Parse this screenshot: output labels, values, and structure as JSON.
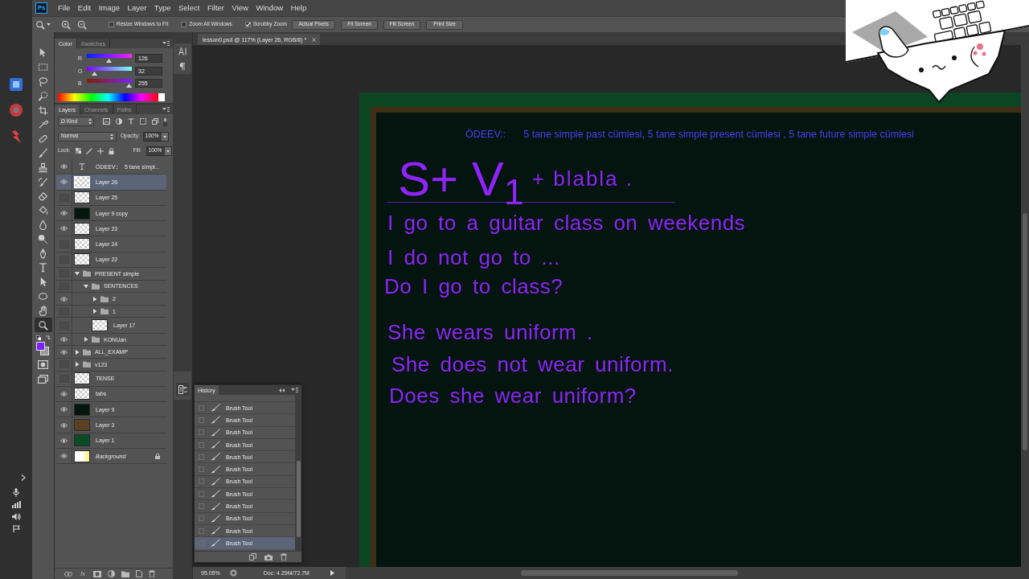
{
  "menu_bar": {
    "logo": "Ps",
    "items": [
      "File",
      "Edit",
      "Image",
      "Layer",
      "Type",
      "Select",
      "Filter",
      "View",
      "Window",
      "Help"
    ]
  },
  "options_bar": {
    "checkboxes": [
      {
        "label": "Resize Windows to Fit",
        "checked": false
      },
      {
        "label": "Zoom All Windows",
        "checked": false
      },
      {
        "label": "Scrubby Zoom",
        "checked": true
      }
    ],
    "buttons": [
      "Actual Pixels",
      "Fit Screen",
      "Fill Screen",
      "Print Size"
    ]
  },
  "toolbox": {
    "tools": [
      {
        "kind": "move",
        "selected": false
      },
      {
        "kind": "marquee",
        "selected": false
      },
      {
        "kind": "lasso",
        "selected": false
      },
      {
        "kind": "quick_select",
        "selected": false
      },
      {
        "kind": "crop",
        "selected": false
      },
      {
        "kind": "eyedropper",
        "selected": false
      },
      {
        "kind": "healing",
        "selected": false
      },
      {
        "kind": "brush",
        "selected": false
      },
      {
        "kind": "stamp",
        "selected": false
      },
      {
        "kind": "history_brush",
        "selected": false
      },
      {
        "kind": "eraser",
        "selected": false
      },
      {
        "kind": "bucket",
        "selected": false
      },
      {
        "kind": "blur",
        "selected": false
      },
      {
        "kind": "dodge",
        "selected": false
      },
      {
        "kind": "pen",
        "selected": false
      },
      {
        "kind": "type",
        "selected": false
      },
      {
        "kind": "path_select",
        "selected": false
      },
      {
        "kind": "ellipse",
        "selected": false
      },
      {
        "kind": "hand",
        "selected": false
      },
      {
        "kind": "zoom",
        "selected": true
      }
    ],
    "swatches": [
      {
        "kind": "foreground",
        "color": "#7e20ff"
      },
      {
        "kind": "background",
        "color": "#9a9a9a"
      }
    ]
  },
  "color_panel": {
    "tabs": [
      {
        "label": "Color",
        "selected": true
      },
      {
        "label": "Swatches",
        "selected": false
      }
    ],
    "sliders": [
      {
        "label": "R",
        "value": "126",
        "level": 0.49
      },
      {
        "label": "G",
        "value": "32",
        "level": 0.13
      },
      {
        "label": "B",
        "value": "255",
        "level": 1
      }
    ]
  },
  "layers_panel": {
    "tabs": [
      {
        "label": "Layers",
        "selected": true
      },
      {
        "label": "Channels",
        "selected": false
      },
      {
        "label": "Paths",
        "selected": false
      }
    ],
    "filter": "Kind",
    "filter_on": true,
    "blend_mode": "Normal",
    "opacity_label": "Opacity:",
    "opacity": "100%",
    "lock_label": "Lock:",
    "fill_label": "Fill:",
    "fill": "100%",
    "layers": [
      {
        "kind": "text",
        "name": "ÖDEEV::    5 tane simpl...",
        "visible": true,
        "selected": false
      },
      {
        "kind": "layer",
        "name": "Layer 26",
        "visible": true,
        "selected": true
      },
      {
        "kind": "layer",
        "name": "Layer 25",
        "visible": false,
        "selected": false
      },
      {
        "kind": "fill",
        "name": "Layer 9 copy",
        "visible": true,
        "selected": false,
        "color": "#03170f"
      },
      {
        "kind": "layer",
        "name": "Layer 23",
        "visible": true,
        "selected": false
      },
      {
        "kind": "layer",
        "name": "Layer 24",
        "visible": false,
        "selected": false
      },
      {
        "kind": "layer",
        "name": "Layer 22",
        "visible": false,
        "selected": false
      },
      {
        "kind": "group",
        "name": "PRESENT simple",
        "visible": false,
        "selected": false,
        "expanded": true,
        "children": [
          {
            "kind": "group",
            "name": "SENTENCES",
            "visible": false,
            "selected": false,
            "expanded": true,
            "children": [
              {
                "kind": "group",
                "name": "2",
                "visible": true,
                "selected": false,
                "expanded": false
              },
              {
                "kind": "group",
                "name": "1",
                "visible": false,
                "selected": false,
                "expanded": false
              },
              {
                "kind": "layer",
                "name": "Layer 17",
                "visible": false,
                "selected": false
              }
            ]
          },
          {
            "kind": "group",
            "name": "KONUan",
            "visible": true,
            "selected": false,
            "expanded": false
          }
        ]
      },
      {
        "kind": "group",
        "name": "ALL_EXAMP",
        "visible": true,
        "selected": false,
        "expanded": false
      },
      {
        "kind": "group",
        "name": "v123",
        "visible": false,
        "selected": false,
        "expanded": false
      },
      {
        "kind": "layer",
        "name": "TENSE",
        "visible": false,
        "selected": false
      },
      {
        "kind": "layer",
        "name": "tabs",
        "visible": true,
        "selected": false
      },
      {
        "kind": "fill",
        "name": "Layer 9",
        "visible": true,
        "selected": false,
        "color": "#03170f"
      },
      {
        "kind": "fill",
        "name": "Layer 3",
        "visible": true,
        "selected": false,
        "color": "#5a4020"
      },
      {
        "kind": "fill",
        "name": "Layer 1",
        "visible": true,
        "selected": false,
        "color": "#0b4a26"
      },
      {
        "kind": "background",
        "name": "Background",
        "visible": true,
        "selected": false
      }
    ],
    "effects_button": "fx"
  },
  "document": {
    "tab": "lesson0.psd @ 117% (Layer 26, RGB/8) *",
    "assignment_label": "ÖDEEV::",
    "assignment": "5 tane simple past cümlesi, 5 tane simple present cümlesi , 5 tane future simple cümlesi",
    "formula": "S+ V$_{1}$",
    "formula_note": "+ blabla .",
    "sentences": [
      "I go to a guitar class on weekends",
      "I do not go to ...",
      "Do I go to class?",
      "She wears uniform .",
      "She does not wear uniform.",
      "Does she wear uniform?"
    ]
  },
  "history_panel": {
    "title": "History",
    "states": [
      {
        "label": "Brush Tool",
        "selected": false
      },
      {
        "label": "Brush Tool",
        "selected": false
      },
      {
        "label": "Brush Tool",
        "selected": false
      },
      {
        "label": "Brush Tool",
        "selected": false
      },
      {
        "label": "Brush Tool",
        "selected": false
      },
      {
        "label": "Brush Tool",
        "selected": false
      },
      {
        "label": "Brush Tool",
        "selected": false
      },
      {
        "label": "Brush Tool",
        "selected": false
      },
      {
        "label": "Brush Tool",
        "selected": false
      },
      {
        "label": "Brush Tool",
        "selected": false
      },
      {
        "label": "Brush Tool",
        "selected": false
      },
      {
        "label": "Brush Tool",
        "selected": true
      }
    ]
  },
  "status_bar": {
    "zoom": "95.05%",
    "document_size": "Doc: 4.29M/72.7M"
  }
}
